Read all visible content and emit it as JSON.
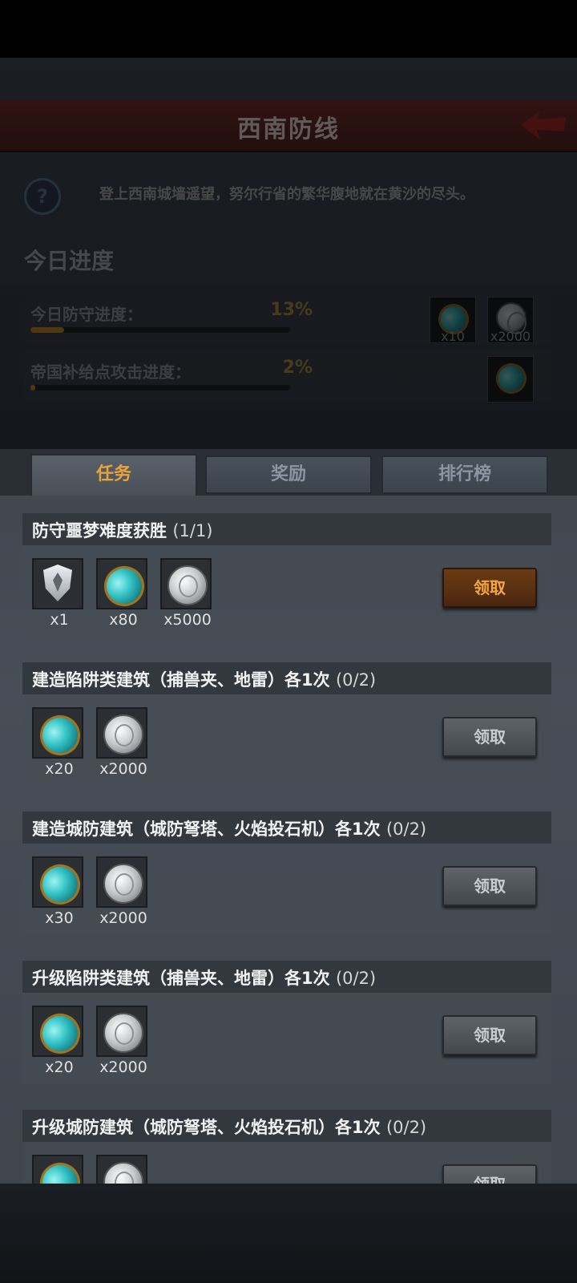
{
  "header": {
    "title": "西南防线"
  },
  "intro": {
    "text": "登上西南城墙遥望，努尔行省的繁华腹地就在黄沙的尽头。"
  },
  "today": {
    "title": "今日进度",
    "rows": [
      {
        "label": "今日防守进度：",
        "percent": "13%",
        "progress": 0.13,
        "rewards": [
          {
            "icon": "gem-icon",
            "count": "x10"
          },
          {
            "icon": "coin-icon",
            "count": "x2000"
          }
        ]
      },
      {
        "label": "帝国补给点攻击进度：",
        "percent": "2%",
        "progress": 0.02,
        "rewards": [
          {
            "icon": "gem-icon",
            "count": ""
          }
        ]
      }
    ]
  },
  "tabs": [
    {
      "label": "任务"
    },
    {
      "label": "奖励"
    },
    {
      "label": "排行榜"
    }
  ],
  "tasks": [
    {
      "title": "防守噩梦难度获胜",
      "progress": "(1/1)",
      "claimable": true,
      "button": "领取",
      "rewards": [
        {
          "icon": "shield-icon",
          "count": "x1"
        },
        {
          "icon": "gem-icon",
          "count": "x80"
        },
        {
          "icon": "coin-icon",
          "count": "x5000"
        }
      ]
    },
    {
      "title": "建造陷阱类建筑（捕兽夹、地雷）各1次",
      "progress": "(0/2)",
      "claimable": false,
      "button": "领取",
      "rewards": [
        {
          "icon": "gem-icon",
          "count": "x20"
        },
        {
          "icon": "coin-icon",
          "count": "x2000"
        }
      ]
    },
    {
      "title": "建造城防建筑（城防弩塔、火焰投石机）各1次",
      "progress": "(0/2)",
      "claimable": false,
      "button": "领取",
      "rewards": [
        {
          "icon": "gem-icon",
          "count": "x30"
        },
        {
          "icon": "coin-icon",
          "count": "x2000"
        }
      ]
    },
    {
      "title": "升级陷阱类建筑（捕兽夹、地雷）各1次",
      "progress": "(0/2)",
      "claimable": false,
      "button": "领取",
      "rewards": [
        {
          "icon": "gem-icon",
          "count": "x20"
        },
        {
          "icon": "coin-icon",
          "count": "x2000"
        }
      ]
    },
    {
      "title": "升级城防建筑（城防弩塔、火焰投石机）各1次",
      "progress": "(0/2)",
      "claimable": false,
      "button": "领取",
      "rewards": [
        {
          "icon": "gem-icon",
          "count": ""
        },
        {
          "icon": "coin-icon",
          "count": ""
        }
      ]
    }
  ],
  "colors": {
    "accent": "#f3a73e",
    "header_red": "#4a1f1c",
    "progress_fill": "#7a5518"
  }
}
